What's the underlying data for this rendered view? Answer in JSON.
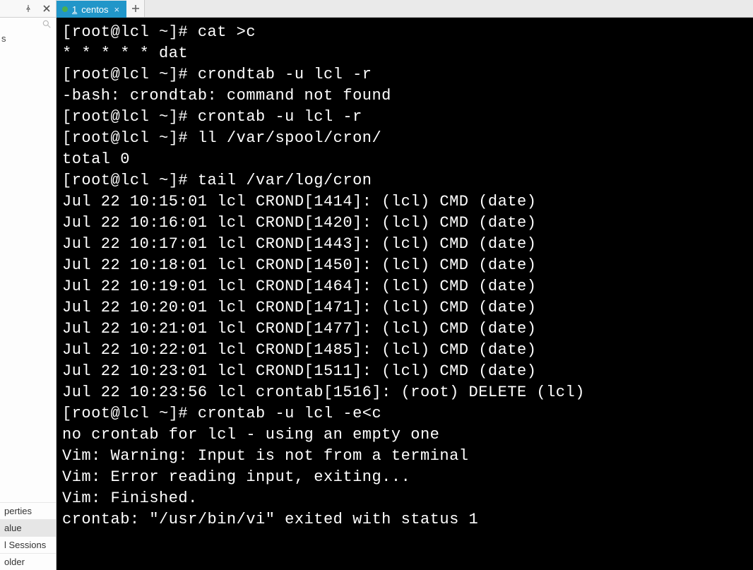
{
  "tabs": {
    "active_number": "1",
    "active_label": "centos"
  },
  "sidebar": {
    "top_item": "s",
    "items": [
      "perties",
      "alue",
      "l Sessions",
      "older"
    ],
    "selected_index": 1
  },
  "terminal": {
    "lines": [
      "[root@lcl ~]# cat >c",
      "* * * * * dat",
      "[root@lcl ~]# crondtab -u lcl -r",
      "-bash: crondtab: command not found",
      "[root@lcl ~]# crontab -u lcl -r",
      "[root@lcl ~]# ll /var/spool/cron/",
      "total 0",
      "[root@lcl ~]# tail /var/log/cron",
      "Jul 22 10:15:01 lcl CROND[1414]: (lcl) CMD (date)",
      "Jul 22 10:16:01 lcl CROND[1420]: (lcl) CMD (date)",
      "Jul 22 10:17:01 lcl CROND[1443]: (lcl) CMD (date)",
      "Jul 22 10:18:01 lcl CROND[1450]: (lcl) CMD (date)",
      "Jul 22 10:19:01 lcl CROND[1464]: (lcl) CMD (date)",
      "Jul 22 10:20:01 lcl CROND[1471]: (lcl) CMD (date)",
      "Jul 22 10:21:01 lcl CROND[1477]: (lcl) CMD (date)",
      "Jul 22 10:22:01 lcl CROND[1485]: (lcl) CMD (date)",
      "Jul 22 10:23:01 lcl CROND[1511]: (lcl) CMD (date)",
      "Jul 22 10:23:56 lcl crontab[1516]: (root) DELETE (lcl)",
      "[root@lcl ~]# crontab -u lcl -e<c",
      "no crontab for lcl - using an empty one",
      "Vim: Warning: Input is not from a terminal",
      "Vim: Error reading input, exiting...",
      "Vim: Finished.",
      "crontab: \"/usr/bin/vi\" exited with status 1"
    ]
  }
}
